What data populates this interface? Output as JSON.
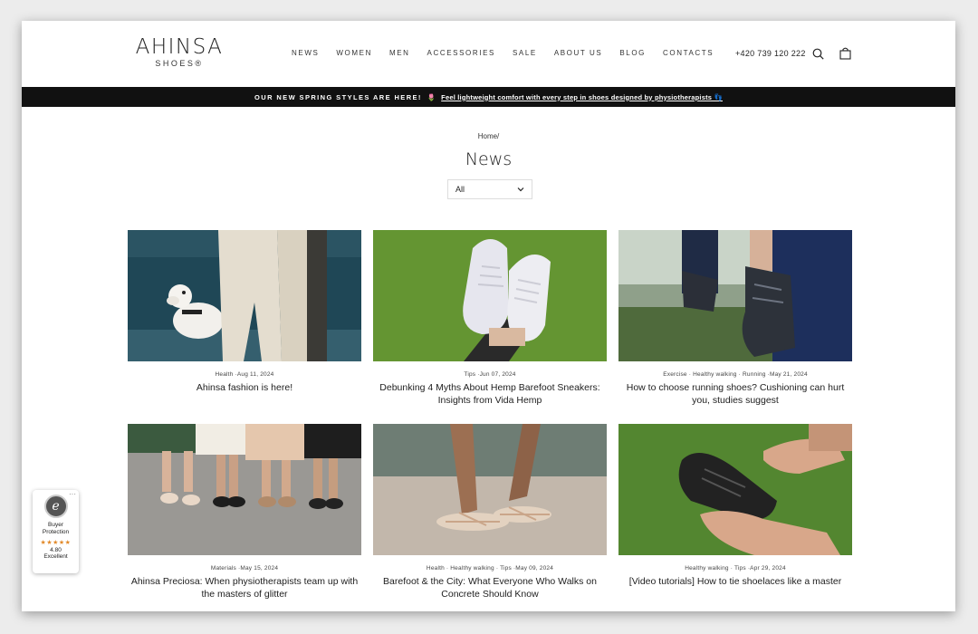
{
  "header": {
    "logo_main": "AHINSA",
    "logo_sub": "SHOES®",
    "nav": [
      "NEWS",
      "WOMEN",
      "MEN",
      "ACCESSORIES",
      "SALE",
      "ABOUT US",
      "BLOG",
      "CONTACTS"
    ],
    "phone": "+420 739 120 222",
    "search_icon": "search-icon",
    "cart_icon": "shopping-bag-icon"
  },
  "announcement": {
    "caps": "OUR NEW SPRING STYLES ARE HERE!",
    "emoji": "🌷",
    "link": "Feel lightweight comfort with every step in shoes designed by physiotherapists 👣"
  },
  "breadcrumb": "Home/",
  "page_title": "News",
  "filter": {
    "selected": "All"
  },
  "articles": [
    {
      "meta": "Health ·Aug 11, 2024",
      "title": "Ahinsa fashion is here!"
    },
    {
      "meta": "Tips ·Jun 07, 2024",
      "title": "Debunking 4 Myths About Hemp Barefoot Sneakers: Insights from Vida Hemp"
    },
    {
      "meta": "Exercise · Healthy walking · Running ·May 21, 2024",
      "title": "How to choose running shoes? Cushioning can hurt you, studies suggest"
    },
    {
      "meta": "Materials ·May 15, 2024",
      "title": "Ahinsa Preciosa: When physiotherapists team up with the masters of glitter"
    },
    {
      "meta": "Health · Healthy walking · Tips ·May 09, 2024",
      "title": "Barefoot & the City: What Everyone Who Walks on Concrete Should Know"
    },
    {
      "meta": "Healthy walking · Tips ·Apr 29, 2024",
      "title": "[Video tutorials] How to tie shoelaces like a master"
    }
  ],
  "trust_badge": {
    "line1": "Buyer",
    "line2": "Protection",
    "stars": "★★★★★",
    "score": "4.80",
    "rating": "Excellent",
    "dots": "···",
    "seal": "e"
  }
}
